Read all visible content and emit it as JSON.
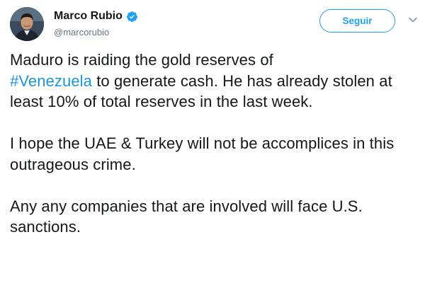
{
  "user": {
    "display_name": "Marco Rubio",
    "handle": "@marcorubio",
    "verified": true
  },
  "actions": {
    "follow_label": "Seguir"
  },
  "tweet": {
    "p1_before": "Maduro is raiding the gold reserves of",
    "p1_hashtag": "#Venezuela",
    "p1_after": " to generate cash. He has already stolen at least 10% of total reserves in the last week.",
    "p2": "I hope the UAE & Turkey will not be accomplices in this outrageous crime.",
    "p3": "Any any companies that are involved will face U.S. sanctions."
  },
  "colors": {
    "accent": "#1da1f2",
    "hashtag": "#1b95e0",
    "text": "#14171a",
    "muted": "#657786"
  },
  "icons": [
    "avatar",
    "verified-badge-icon",
    "chevron-down-icon"
  ]
}
